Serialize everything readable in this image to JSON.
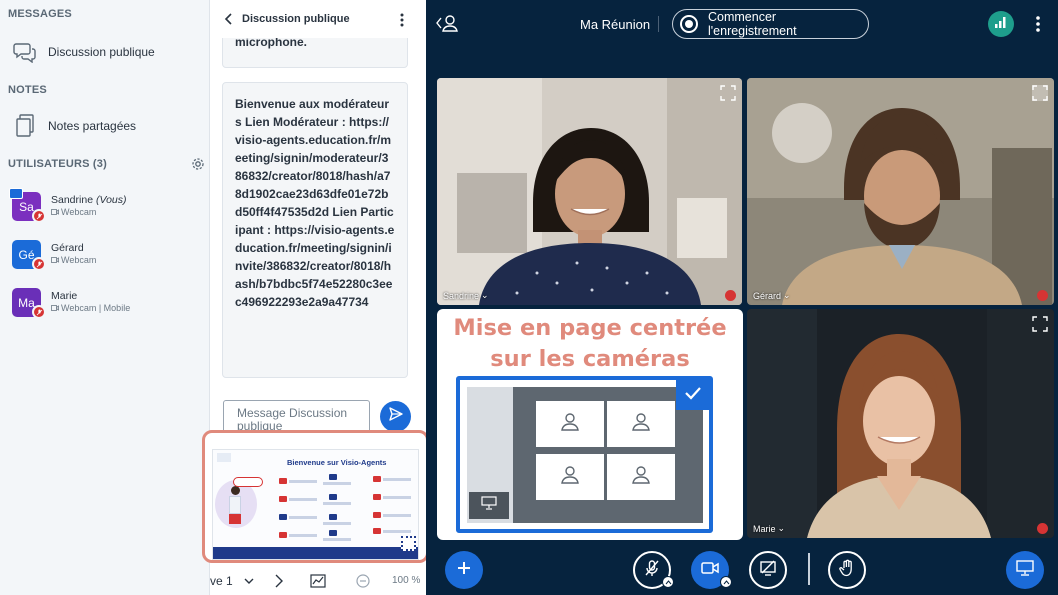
{
  "sidebar": {
    "messages_title": "MESSAGES",
    "public_chat": "Discussion publique",
    "notes_title": "NOTES",
    "shared_notes": "Notes partagées",
    "users_title": "UTILISATEURS (3)",
    "users": [
      {
        "initials": "Sa",
        "name": "Sandrine",
        "you": "(Vous)",
        "status": "Webcam",
        "color": "#7b2fbf"
      },
      {
        "initials": "Gé",
        "name": "Gérard",
        "you": "",
        "status": "Webcam",
        "color": "#1b6bd8"
      },
      {
        "initials": "Ma",
        "name": "Marie",
        "you": "",
        "status": "Webcam | Mobile",
        "color": "#6a2fb8"
      }
    ]
  },
  "chat": {
    "title": "Discussion publique",
    "prev_message": "microphone.",
    "message": "Bienvenue aux modérateurs Lien Modérateur : https://visio-agents.education.fr/meeting/signin/moderateur/386832/creator/8018/hash/a78d1902cae23d63dfe01e72bd50ff4f47535d2d Lien Participant : https://visio-agents.education.fr/meeting/signin/invite/386832/creator/8018/hash/b7bdbc5f74e52280c3eec496922293e2a9a47734",
    "input_placeholder": "Message Discussion publique"
  },
  "presentation": {
    "slide_title": "Bienvenue sur Visio-Agents",
    "slide_label": "ve 1",
    "zoom": "100 %"
  },
  "topbar": {
    "meeting_title": "Ma Réunion",
    "record_label": "Commencer l'enregistrement"
  },
  "tiles": [
    {
      "name": "Sandrine"
    },
    {
      "name": "Gérard"
    },
    {
      "name": "Marie"
    }
  ],
  "callout": {
    "line1": "Mise en page centrée",
    "line2": "sur les caméras"
  },
  "colors": {
    "accent": "#1b6bd8",
    "callout": "#e08a7c",
    "bg": "#06233e",
    "muted": "#d63434"
  }
}
